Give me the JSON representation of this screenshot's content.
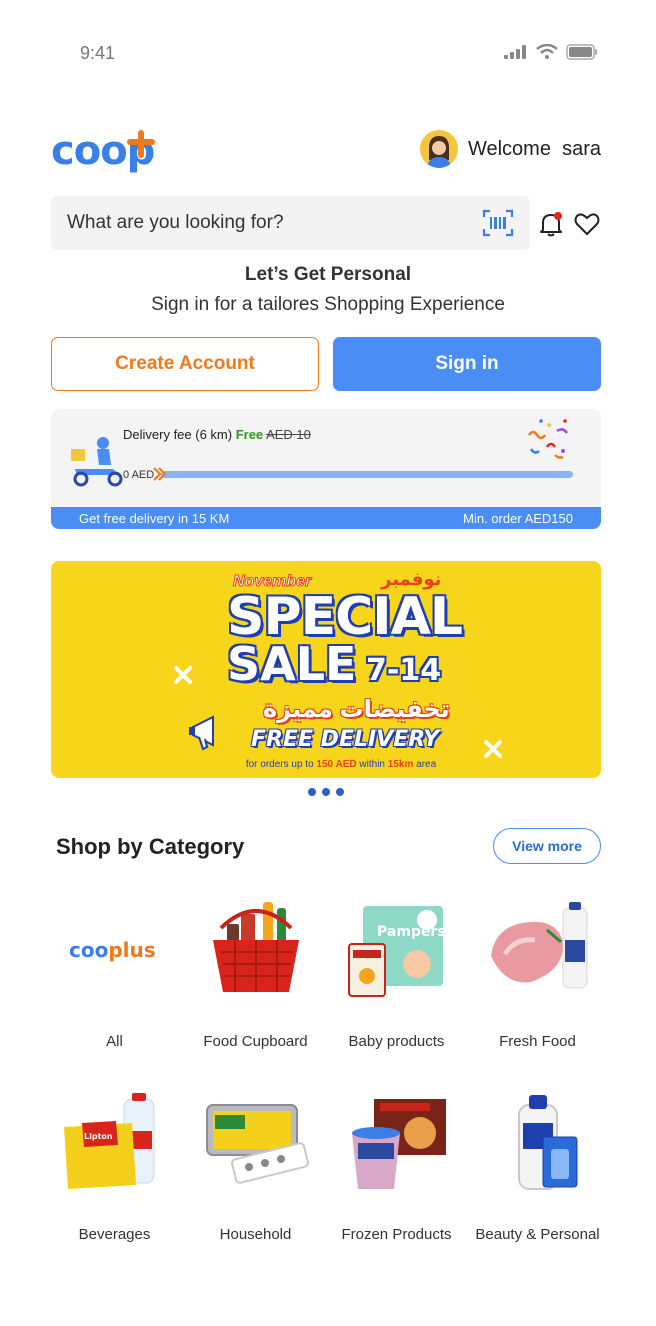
{
  "status_bar": {
    "time": "9:41"
  },
  "header": {
    "logo_text": "coop",
    "welcome_label": "Welcome",
    "user_name": "sara"
  },
  "search": {
    "placeholder": "What are you looking for?"
  },
  "personal": {
    "title": "Let’s Get Personal",
    "subtitle": "Sign in for a tailores Shopping Experience"
  },
  "auth": {
    "create_account_label": "Create Account",
    "sign_in_label": "Sign in"
  },
  "delivery": {
    "fee_label": "Delivery fee (6 km)",
    "fee_free": "Free",
    "fee_old": "AED 10",
    "progress_start": "0 AED",
    "progress_fraction": 0,
    "footer_left": "Get free delivery in 15 KM",
    "footer_right": "Min. order AED150"
  },
  "banner": {
    "month_en": "November",
    "month_ar": "نوفمبر",
    "headline_1": "SPECIAL",
    "headline_2": "SALE",
    "dates": "7-14",
    "subtitle_ar": "تخفيضات مميزة",
    "free_delivery": "FREE DELIVERY",
    "terms_prefix": "for orders up to",
    "terms_amount": "150 AED",
    "terms_mid": "within",
    "terms_distance": "15km",
    "terms_suffix": "area"
  },
  "carousel": {
    "dot_count": 3
  },
  "categories": {
    "title": "Shop by Category",
    "view_more_label": "View more",
    "items": [
      {
        "label": "All",
        "logo_text_1": "coo",
        "logo_text_2": "plus"
      },
      {
        "label": "Food Cupboard"
      },
      {
        "label": "Baby products"
      },
      {
        "label": "Fresh Food"
      },
      {
        "label": "Beverages"
      },
      {
        "label": "Household"
      },
      {
        "label": "Frozen Products"
      },
      {
        "label": "Beauty & Personal"
      }
    ]
  },
  "colors": {
    "brand_blue": "#4a8df5",
    "brand_orange": "#f07a1a",
    "banner_yellow": "#f7d51a"
  }
}
